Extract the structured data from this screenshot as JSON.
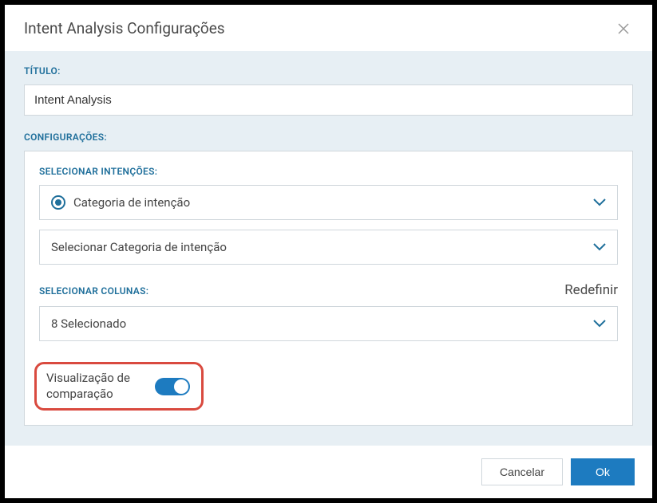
{
  "modal": {
    "title": "Intent Analysis Configurações",
    "titleLabel": "TÍTULO:",
    "titleValue": "Intent Analysis",
    "configLabel": "CONFIGURAÇÕES:",
    "selectIntentsLabel": "SELECIONAR INTENÇÕES:",
    "intentCategoryLabel": "Categoria de intenção",
    "selectIntentCategoryLabel": "Selecionar Categoria de intenção",
    "selectColumnsLabel": "SELECIONAR COLUNAS:",
    "resetLabel": "Redefinir",
    "selectedCountLabel": "8 Selecionado",
    "comparisonViewLabel": "Visualização de comparação",
    "cancelLabel": "Cancelar",
    "okLabel": "Ok"
  }
}
